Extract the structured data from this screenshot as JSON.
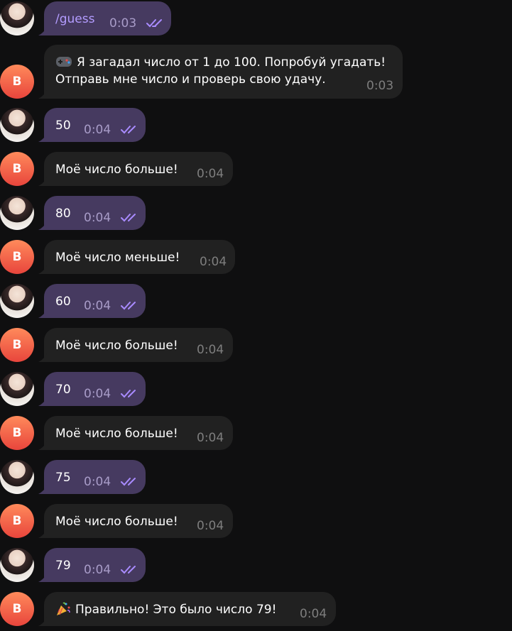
{
  "avatar": {
    "bot_initial": "B",
    "user_icon": "user-avatar-photo"
  },
  "colors": {
    "background": "#0f0f10",
    "outgoing_bubble": "#463a60",
    "incoming_bubble": "#212121",
    "command_text": "#b39cff",
    "read_check": "#a98bff"
  },
  "messages": [
    {
      "sender": "user",
      "text": "/guess",
      "time": "0:03"
    },
    {
      "sender": "bot",
      "line1": "Я загадал число от 1 до 100. Попробуй угадать!",
      "line2": "Отправь мне число и проверь свою удачу.",
      "time": "0:03",
      "icon": "video-game-emoji"
    },
    {
      "sender": "user",
      "text": "50",
      "time": "0:04"
    },
    {
      "sender": "bot",
      "text": "Моё число больше!",
      "time": "0:04"
    },
    {
      "sender": "user",
      "text": "80",
      "time": "0:04"
    },
    {
      "sender": "bot",
      "text": "Моё число меньше!",
      "time": "0:04"
    },
    {
      "sender": "user",
      "text": "60",
      "time": "0:04"
    },
    {
      "sender": "bot",
      "text": "Моё число больше!",
      "time": "0:04"
    },
    {
      "sender": "user",
      "text": "70",
      "time": "0:04"
    },
    {
      "sender": "bot",
      "text": "Моё число больше!",
      "time": "0:04"
    },
    {
      "sender": "user",
      "text": "75",
      "time": "0:04"
    },
    {
      "sender": "bot",
      "text": "Моё число больше!",
      "time": "0:04"
    },
    {
      "sender": "user",
      "text": "79",
      "time": "0:04"
    },
    {
      "sender": "bot",
      "text": "Правильно! Это было число 79!",
      "time": "0:04",
      "icon": "party-popper-emoji"
    }
  ]
}
